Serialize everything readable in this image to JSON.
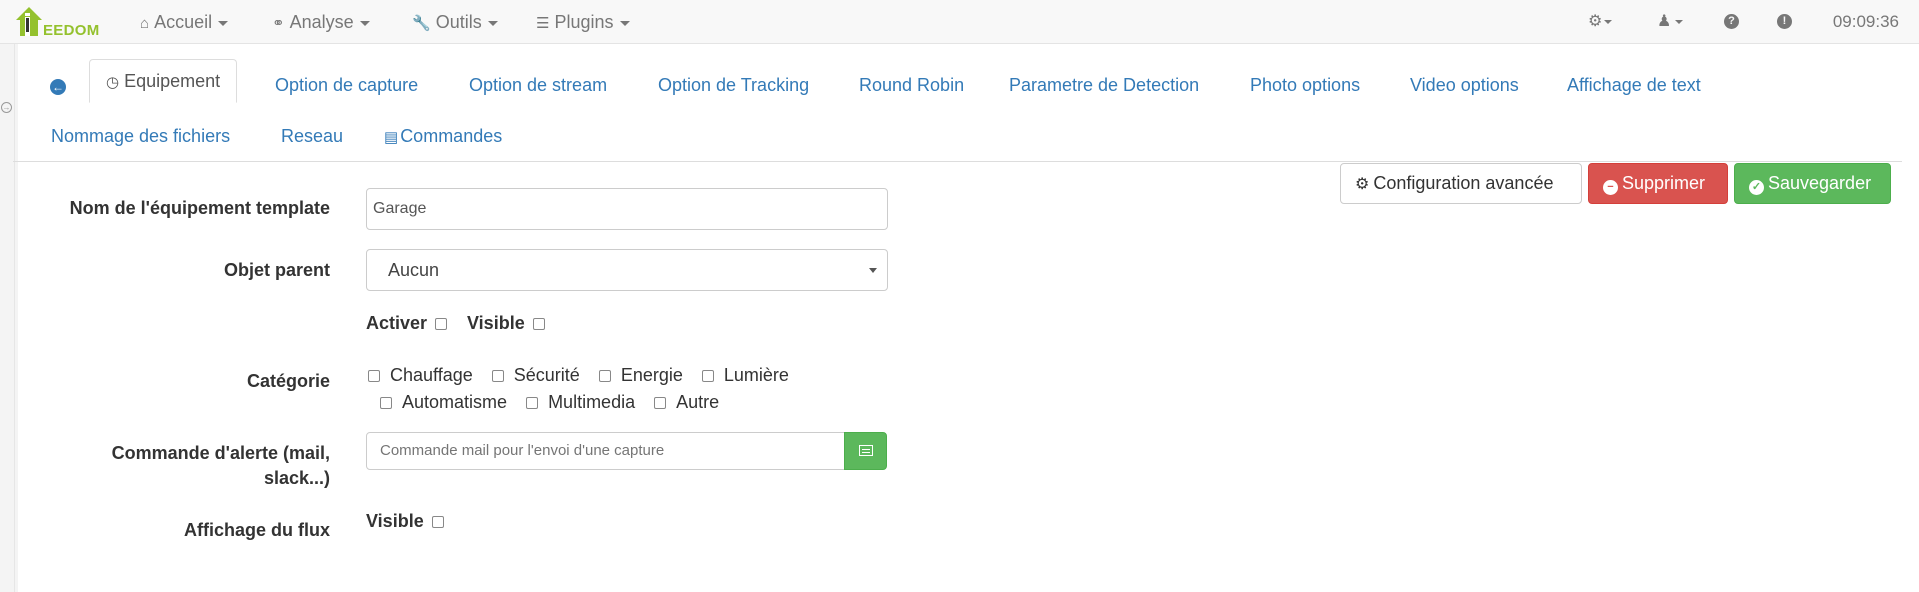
{
  "app": {
    "logo_text": "EEDOM"
  },
  "nav": {
    "items": [
      {
        "label": "Accueil",
        "icon": "home-icon"
      },
      {
        "label": "Analyse",
        "icon": "stethoscope-icon"
      },
      {
        "label": "Outils",
        "icon": "wrench-icon"
      },
      {
        "label": "Plugins",
        "icon": "tasks-icon"
      }
    ],
    "right_icons": [
      "cogs-icon",
      "user-icon",
      "question-circle-icon",
      "exclamation-circle-icon"
    ],
    "clock": "09:09:36"
  },
  "tabs": [
    {
      "label": "Equipement",
      "active": true
    },
    {
      "label": "Option de capture"
    },
    {
      "label": "Option de stream"
    },
    {
      "label": "Option de Tracking"
    },
    {
      "label": "Round Robin"
    },
    {
      "label": "Parametre de Detection"
    },
    {
      "label": "Photo options"
    },
    {
      "label": "Video options"
    },
    {
      "label": "Affichage de text"
    },
    {
      "label": "Nommage des fichiers"
    },
    {
      "label": "Reseau"
    },
    {
      "label": "Commandes"
    }
  ],
  "actions": {
    "config": "Configuration avancée",
    "delete": "Supprimer",
    "save": "Sauvegarder"
  },
  "form": {
    "name_label": "Nom de l'équipement template",
    "name_value": "Garage",
    "parent_label": "Objet parent",
    "parent_value": "Aucun",
    "activate_label": "Activer",
    "visible_label": "Visible",
    "category_label": "Catégorie",
    "categories": [
      "Chauffage",
      "Sécurité",
      "Energie",
      "Lumière",
      "Automatisme",
      "Multimedia",
      "Autre"
    ],
    "alert_label_line1": "Commande d'alerte (mail,",
    "alert_label_line2": "slack...)",
    "alert_placeholder": "Commande mail pour l'envoi d'une capture",
    "flux_label": "Affichage du flux",
    "flux_visible_label": "Visible"
  }
}
